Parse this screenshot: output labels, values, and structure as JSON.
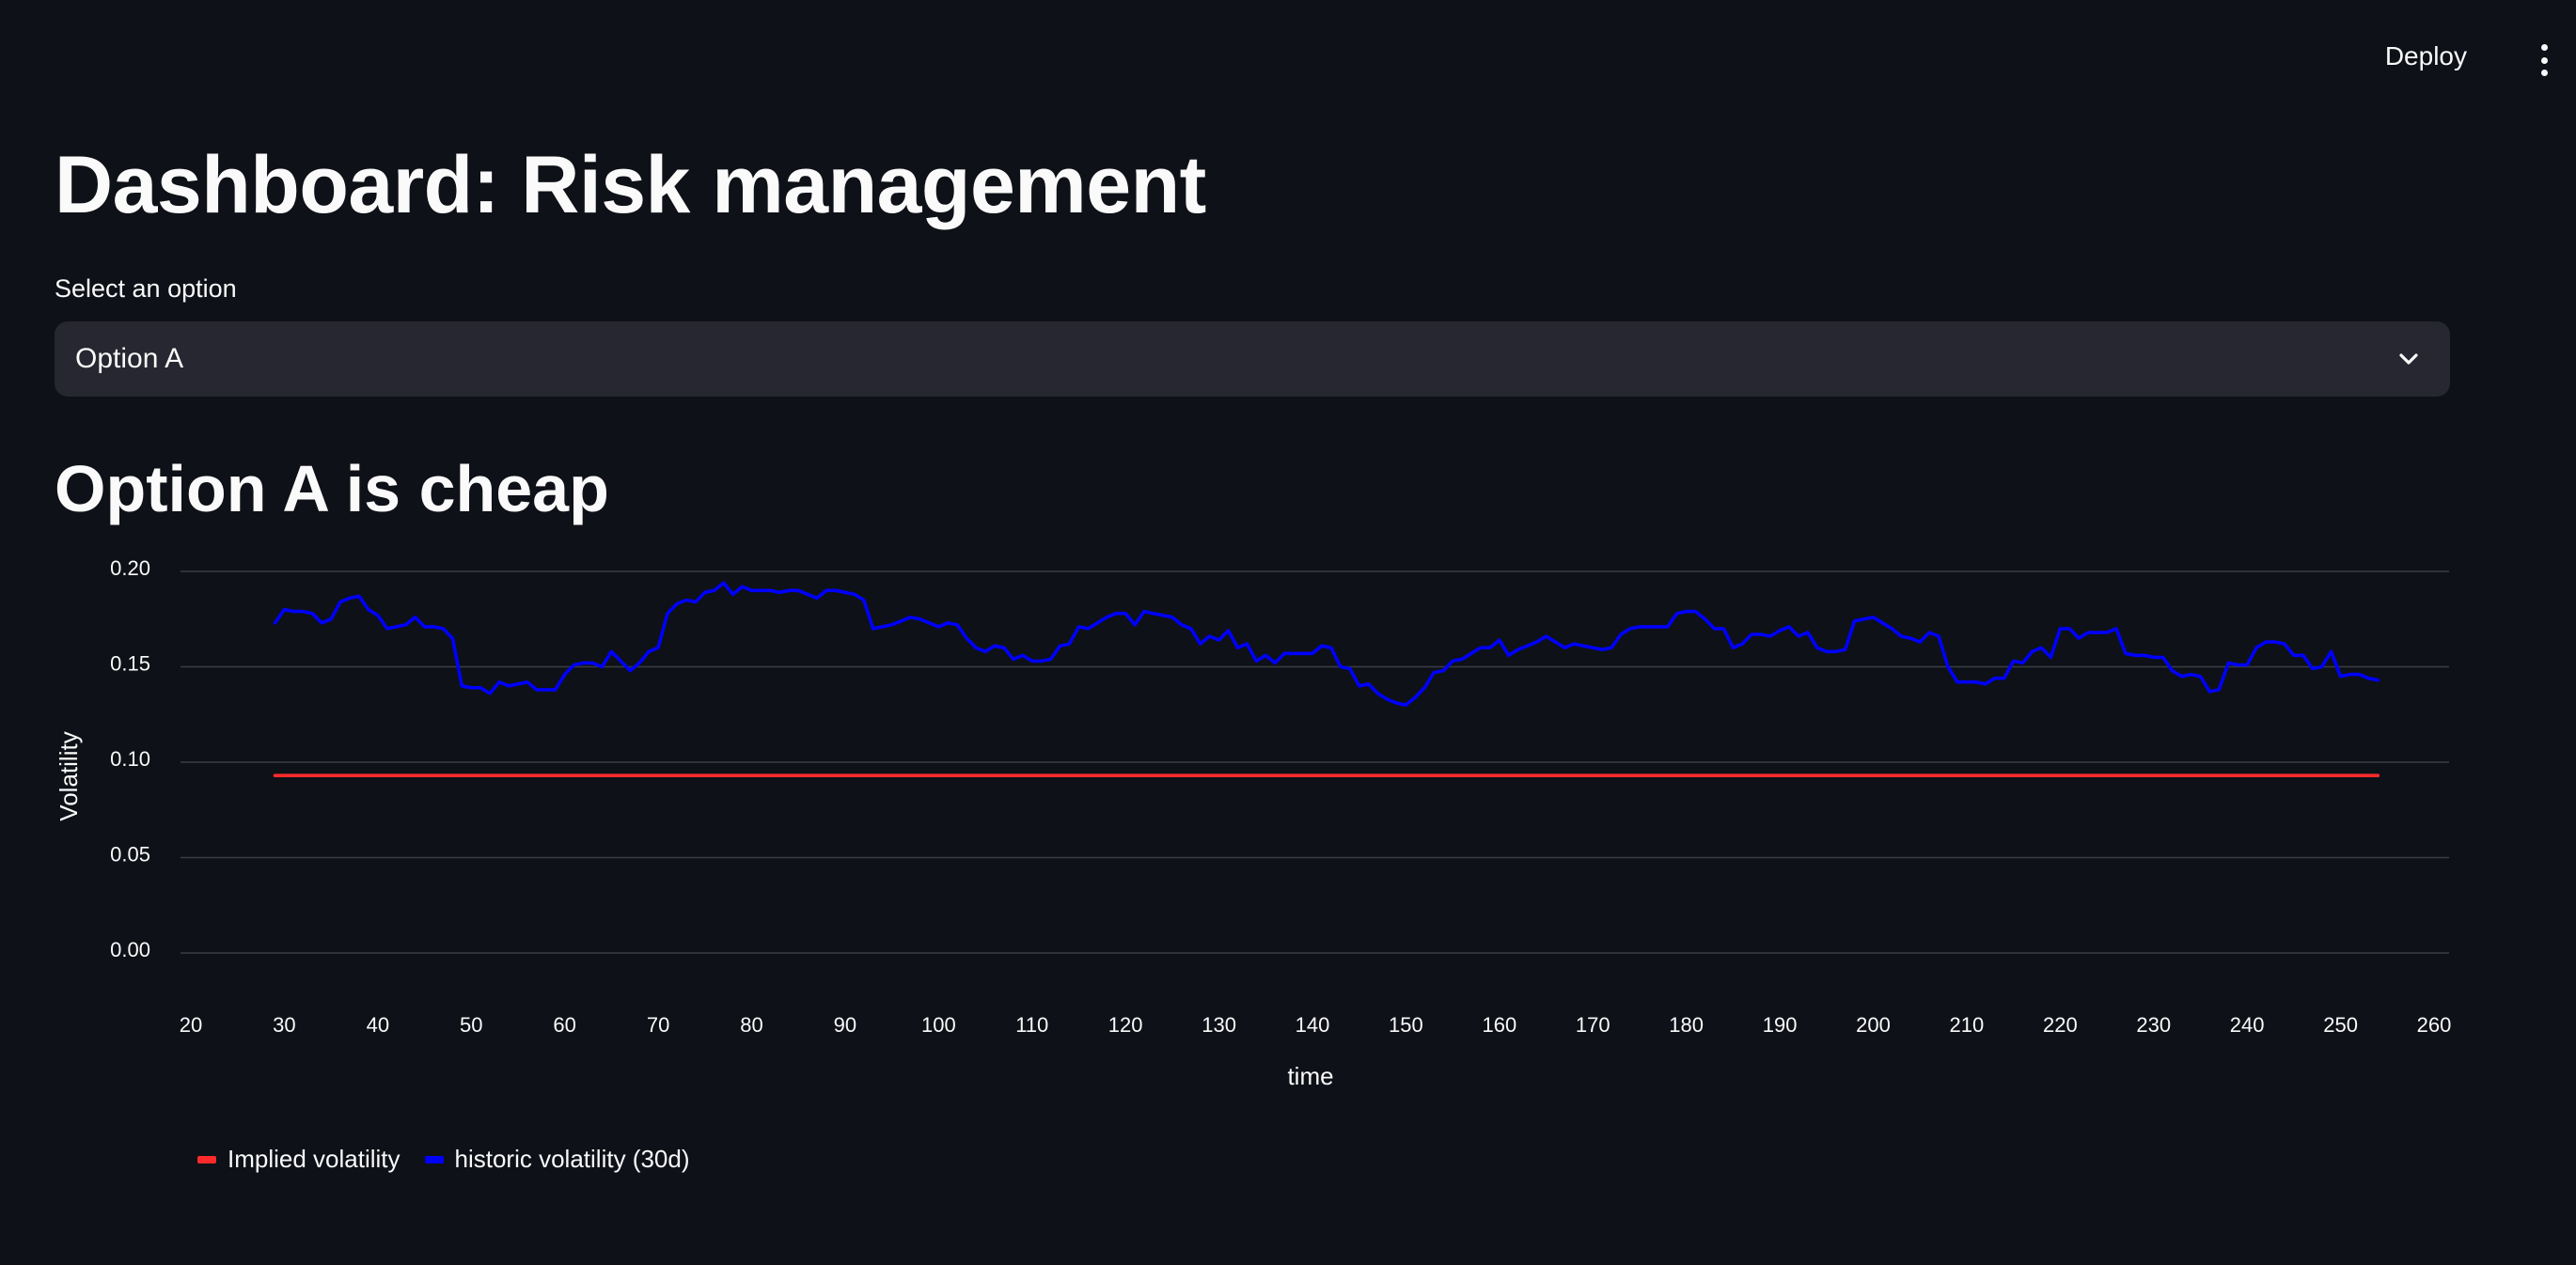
{
  "header": {
    "deploy_label": "Deploy",
    "menu_icon": "more-vertical-icon"
  },
  "page": {
    "title": "Dashboard: Risk management",
    "select_label": "Select an option",
    "select_value": "Option A",
    "select_icon": "chevron-down-icon",
    "subheading": "Option A is cheap"
  },
  "colors": {
    "background": "#0e1117",
    "select_bg": "#262730",
    "implied": "#ff2b2b",
    "historic": "#0000ff",
    "grid": "#3a3d45"
  },
  "chart_data": {
    "type": "line",
    "xlabel": "time",
    "ylabel": "Volatility",
    "xlim": [
      20,
      260
    ],
    "ylim": [
      0,
      0.2
    ],
    "xticks": [
      20,
      30,
      40,
      50,
      60,
      70,
      80,
      90,
      100,
      110,
      120,
      130,
      140,
      150,
      160,
      170,
      180,
      190,
      200,
      210,
      220,
      230,
      240,
      250,
      260
    ],
    "yticks": [
      "0.00",
      "0.05",
      "0.10",
      "0.15",
      "0.20"
    ],
    "grid": "horizontal",
    "legend_position": "bottom-left",
    "series": [
      {
        "name": "Implied volatility",
        "color": "#ff2b2b",
        "points": [
          [
            29,
            0.093
          ],
          [
            254,
            0.093
          ]
        ]
      },
      {
        "name": "historic volatility (30d)",
        "color": "#0000ff",
        "points": [
          [
            29,
            0.173
          ],
          [
            30,
            0.18
          ],
          [
            31,
            0.179
          ],
          [
            32,
            0.179
          ],
          [
            33,
            0.178
          ],
          [
            34,
            0.173
          ],
          [
            35,
            0.175
          ],
          [
            36,
            0.184
          ],
          [
            37,
            0.186
          ],
          [
            38,
            0.187
          ],
          [
            39,
            0.18
          ],
          [
            40,
            0.177
          ],
          [
            41,
            0.17
          ],
          [
            42,
            0.171
          ],
          [
            43,
            0.172
          ],
          [
            44,
            0.176
          ],
          [
            45,
            0.171
          ],
          [
            46,
            0.171
          ],
          [
            47,
            0.17
          ],
          [
            48,
            0.165
          ],
          [
            49,
            0.14
          ],
          [
            50,
            0.139
          ],
          [
            51,
            0.139
          ],
          [
            52,
            0.136
          ],
          [
            53,
            0.142
          ],
          [
            54,
            0.14
          ],
          [
            55,
            0.141
          ],
          [
            56,
            0.142
          ],
          [
            57,
            0.138
          ],
          [
            58,
            0.138
          ],
          [
            59,
            0.138
          ],
          [
            60,
            0.146
          ],
          [
            61,
            0.151
          ],
          [
            62,
            0.152
          ],
          [
            63,
            0.152
          ],
          [
            64,
            0.15
          ],
          [
            65,
            0.158
          ],
          [
            66,
            0.153
          ],
          [
            67,
            0.148
          ],
          [
            68,
            0.152
          ],
          [
            69,
            0.158
          ],
          [
            70,
            0.16
          ],
          [
            71,
            0.178
          ],
          [
            72,
            0.183
          ],
          [
            73,
            0.185
          ],
          [
            74,
            0.184
          ],
          [
            75,
            0.189
          ],
          [
            76,
            0.19
          ],
          [
            77,
            0.194
          ],
          [
            78,
            0.188
          ],
          [
            79,
            0.192
          ],
          [
            80,
            0.19
          ],
          [
            81,
            0.19
          ],
          [
            82,
            0.19
          ],
          [
            83,
            0.189
          ],
          [
            84,
            0.19
          ],
          [
            85,
            0.19
          ],
          [
            86,
            0.188
          ],
          [
            87,
            0.186
          ],
          [
            88,
            0.19
          ],
          [
            89,
            0.19
          ],
          [
            90,
            0.189
          ],
          [
            91,
            0.188
          ],
          [
            92,
            0.185
          ],
          [
            93,
            0.17
          ],
          [
            94,
            0.171
          ],
          [
            95,
            0.172
          ],
          [
            96,
            0.174
          ],
          [
            97,
            0.176
          ],
          [
            98,
            0.175
          ],
          [
            99,
            0.173
          ],
          [
            100,
            0.171
          ],
          [
            101,
            0.173
          ],
          [
            102,
            0.172
          ],
          [
            103,
            0.165
          ],
          [
            104,
            0.16
          ],
          [
            105,
            0.158
          ],
          [
            106,
            0.161
          ],
          [
            107,
            0.16
          ],
          [
            108,
            0.154
          ],
          [
            109,
            0.156
          ],
          [
            110,
            0.153
          ],
          [
            111,
            0.153
          ],
          [
            112,
            0.154
          ],
          [
            113,
            0.161
          ],
          [
            114,
            0.162
          ],
          [
            115,
            0.171
          ],
          [
            116,
            0.17
          ],
          [
            117,
            0.173
          ],
          [
            118,
            0.176
          ],
          [
            119,
            0.178
          ],
          [
            120,
            0.178
          ],
          [
            121,
            0.172
          ],
          [
            122,
            0.179
          ],
          [
            123,
            0.178
          ],
          [
            124,
            0.177
          ],
          [
            125,
            0.176
          ],
          [
            126,
            0.172
          ],
          [
            127,
            0.17
          ],
          [
            128,
            0.162
          ],
          [
            129,
            0.166
          ],
          [
            130,
            0.164
          ],
          [
            131,
            0.169
          ],
          [
            132,
            0.16
          ],
          [
            133,
            0.162
          ],
          [
            134,
            0.153
          ],
          [
            135,
            0.156
          ],
          [
            136,
            0.152
          ],
          [
            137,
            0.157
          ],
          [
            138,
            0.157
          ],
          [
            139,
            0.157
          ],
          [
            140,
            0.157
          ],
          [
            141,
            0.161
          ],
          [
            142,
            0.16
          ],
          [
            143,
            0.15
          ],
          [
            144,
            0.149
          ],
          [
            145,
            0.14
          ],
          [
            146,
            0.141
          ],
          [
            147,
            0.136
          ],
          [
            148,
            0.133
          ],
          [
            149,
            0.131
          ],
          [
            150,
            0.13
          ],
          [
            151,
            0.134
          ],
          [
            152,
            0.139
          ],
          [
            153,
            0.147
          ],
          [
            154,
            0.148
          ],
          [
            155,
            0.153
          ],
          [
            156,
            0.154
          ],
          [
            157,
            0.157
          ],
          [
            158,
            0.16
          ],
          [
            159,
            0.16
          ],
          [
            160,
            0.164
          ],
          [
            161,
            0.156
          ],
          [
            162,
            0.159
          ],
          [
            163,
            0.161
          ],
          [
            164,
            0.163
          ],
          [
            165,
            0.166
          ],
          [
            166,
            0.163
          ],
          [
            167,
            0.16
          ],
          [
            168,
            0.162
          ],
          [
            169,
            0.161
          ],
          [
            170,
            0.16
          ],
          [
            171,
            0.159
          ],
          [
            172,
            0.16
          ],
          [
            173,
            0.167
          ],
          [
            174,
            0.17
          ],
          [
            175,
            0.171
          ],
          [
            176,
            0.171
          ],
          [
            177,
            0.171
          ],
          [
            178,
            0.171
          ],
          [
            179,
            0.178
          ],
          [
            180,
            0.179
          ],
          [
            181,
            0.179
          ],
          [
            182,
            0.175
          ],
          [
            183,
            0.17
          ],
          [
            184,
            0.17
          ],
          [
            185,
            0.16
          ],
          [
            186,
            0.162
          ],
          [
            187,
            0.167
          ],
          [
            188,
            0.167
          ],
          [
            189,
            0.166
          ],
          [
            190,
            0.169
          ],
          [
            191,
            0.171
          ],
          [
            192,
            0.166
          ],
          [
            193,
            0.168
          ],
          [
            194,
            0.16
          ],
          [
            195,
            0.158
          ],
          [
            196,
            0.158
          ],
          [
            197,
            0.159
          ],
          [
            198,
            0.174
          ],
          [
            199,
            0.175
          ],
          [
            200,
            0.176
          ],
          [
            201,
            0.173
          ],
          [
            202,
            0.17
          ],
          [
            203,
            0.166
          ],
          [
            204,
            0.165
          ],
          [
            205,
            0.163
          ],
          [
            206,
            0.168
          ],
          [
            207,
            0.166
          ],
          [
            208,
            0.15
          ],
          [
            209,
            0.142
          ],
          [
            210,
            0.142
          ],
          [
            211,
            0.142
          ],
          [
            212,
            0.141
          ],
          [
            213,
            0.144
          ],
          [
            214,
            0.144
          ],
          [
            215,
            0.153
          ],
          [
            216,
            0.152
          ],
          [
            217,
            0.158
          ],
          [
            218,
            0.16
          ],
          [
            219,
            0.155
          ],
          [
            220,
            0.17
          ],
          [
            221,
            0.17
          ],
          [
            222,
            0.165
          ],
          [
            223,
            0.168
          ],
          [
            224,
            0.168
          ],
          [
            225,
            0.168
          ],
          [
            226,
            0.17
          ],
          [
            227,
            0.157
          ],
          [
            228,
            0.156
          ],
          [
            229,
            0.156
          ],
          [
            230,
            0.155
          ],
          [
            231,
            0.155
          ],
          [
            232,
            0.148
          ],
          [
            233,
            0.145
          ],
          [
            234,
            0.146
          ],
          [
            235,
            0.145
          ],
          [
            236,
            0.137
          ],
          [
            237,
            0.138
          ],
          [
            238,
            0.152
          ],
          [
            239,
            0.151
          ],
          [
            240,
            0.151
          ],
          [
            241,
            0.16
          ],
          [
            242,
            0.163
          ],
          [
            243,
            0.163
          ],
          [
            244,
            0.162
          ],
          [
            245,
            0.156
          ],
          [
            246,
            0.156
          ],
          [
            247,
            0.149
          ],
          [
            248,
            0.15
          ],
          [
            249,
            0.158
          ],
          [
            250,
            0.145
          ],
          [
            251,
            0.146
          ],
          [
            252,
            0.146
          ],
          [
            253,
            0.144
          ],
          [
            254,
            0.143
          ]
        ]
      }
    ]
  }
}
